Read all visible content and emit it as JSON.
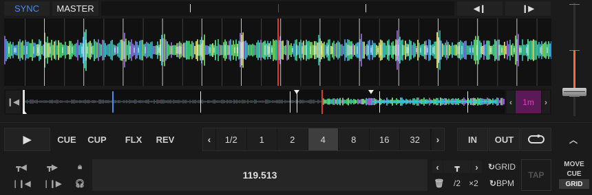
{
  "top": {
    "sync_label": "SYNC",
    "master_label": "MASTER",
    "nudge_back_icon": "nudge-back-icon",
    "nudge_forward_icon": "nudge-forward-icon"
  },
  "overview": {
    "loop_length": "1m",
    "skip_to_start_icon": "skip-to-start-icon",
    "playhead_fraction": 0.62
  },
  "transport": {
    "play_icon": "play-icon",
    "cue_label": "CUE",
    "cup_label": "CUP",
    "flx_label": "FLX",
    "rev_label": "REV"
  },
  "loop_sizes": {
    "options": [
      "1/2",
      "1",
      "2",
      "4",
      "8",
      "16",
      "32"
    ],
    "selected": "4"
  },
  "loop_controls": {
    "in_label": "IN",
    "out_label": "OUT",
    "loop_icon": "loop-icon",
    "collapse_icon": "chevron-up-icon"
  },
  "bottom": {
    "bpm_value": "119.513",
    "half_label": "/2",
    "double_label": "×2",
    "grid_label": "GRID",
    "bpm_label": "BPM",
    "tap_label": "TAP",
    "move_label": "MOVE",
    "cue_label": "CUE",
    "grid_tab_label": "GRID"
  },
  "colors": {
    "sync_blue": "#4d8df0",
    "playhead_red": "#e03a2a",
    "loop_magenta": "#e040c8",
    "tempo_orange": "#f07030",
    "selected_cell": "#3e3e3e"
  }
}
